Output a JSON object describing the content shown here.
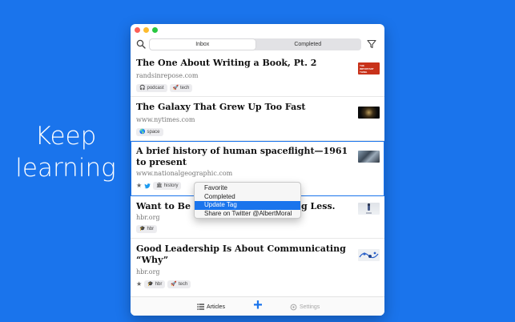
{
  "tagline": {
    "line1": "Keep",
    "line2": "learning"
  },
  "toolbar": {
    "tabs": [
      {
        "label": "Inbox",
        "active": true
      },
      {
        "label": "Completed",
        "active": false
      }
    ]
  },
  "articles": [
    {
      "title": "The One About Writing a Book, Pt. 2",
      "domain": "randsinrepose.com",
      "tags": [
        {
          "icon": "headphones-icon",
          "label": "podcast"
        },
        {
          "icon": "rocket-icon",
          "label": "tech"
        }
      ],
      "thumb_text": "THE IMPORTANT THING",
      "thumb_color": "#c8321a"
    },
    {
      "title": "The Galaxy That Grew Up Too Fast",
      "domain": "www.nytimes.com",
      "tags": [
        {
          "icon": "globe-icon",
          "label": "space"
        }
      ]
    },
    {
      "title": "A brief history of human spaceflight—1961 to present",
      "domain": "www.nationalgeographic.com",
      "tags": [
        {
          "icon": "building-icon",
          "label": "history"
        }
      ]
    },
    {
      "title": "Want to Be M",
      "title_end": "g Less.",
      "domain": "hbr.org",
      "tags": [
        {
          "icon": "graduation-cap-icon",
          "label": "hbr"
        }
      ]
    },
    {
      "title": "Good Leadership Is About Communicating “Why”",
      "domain": "hbr.org",
      "tags": [
        {
          "icon": "graduation-cap-icon",
          "label": "hbr"
        },
        {
          "icon": "rocket-icon",
          "label": "tech"
        }
      ]
    }
  ],
  "context_menu": {
    "items": [
      {
        "label": "Favorite"
      },
      {
        "label": "Completed"
      },
      {
        "label": "Update Tag",
        "highlighted": true
      },
      {
        "label": "Share on Twitter @AlbertMoral"
      }
    ]
  },
  "bottom_bar": {
    "articles_label": "Articles",
    "settings_label": "Settings",
    "plus_glyph": "+"
  },
  "colors": {
    "accent": "#1a74ec",
    "background": "#1a74ec"
  },
  "icons": {
    "favorite": "★",
    "rocket": "🚀",
    "globe": "🌎",
    "headphones": "🎧",
    "building": "🏛",
    "graduation_cap": "🎓"
  }
}
